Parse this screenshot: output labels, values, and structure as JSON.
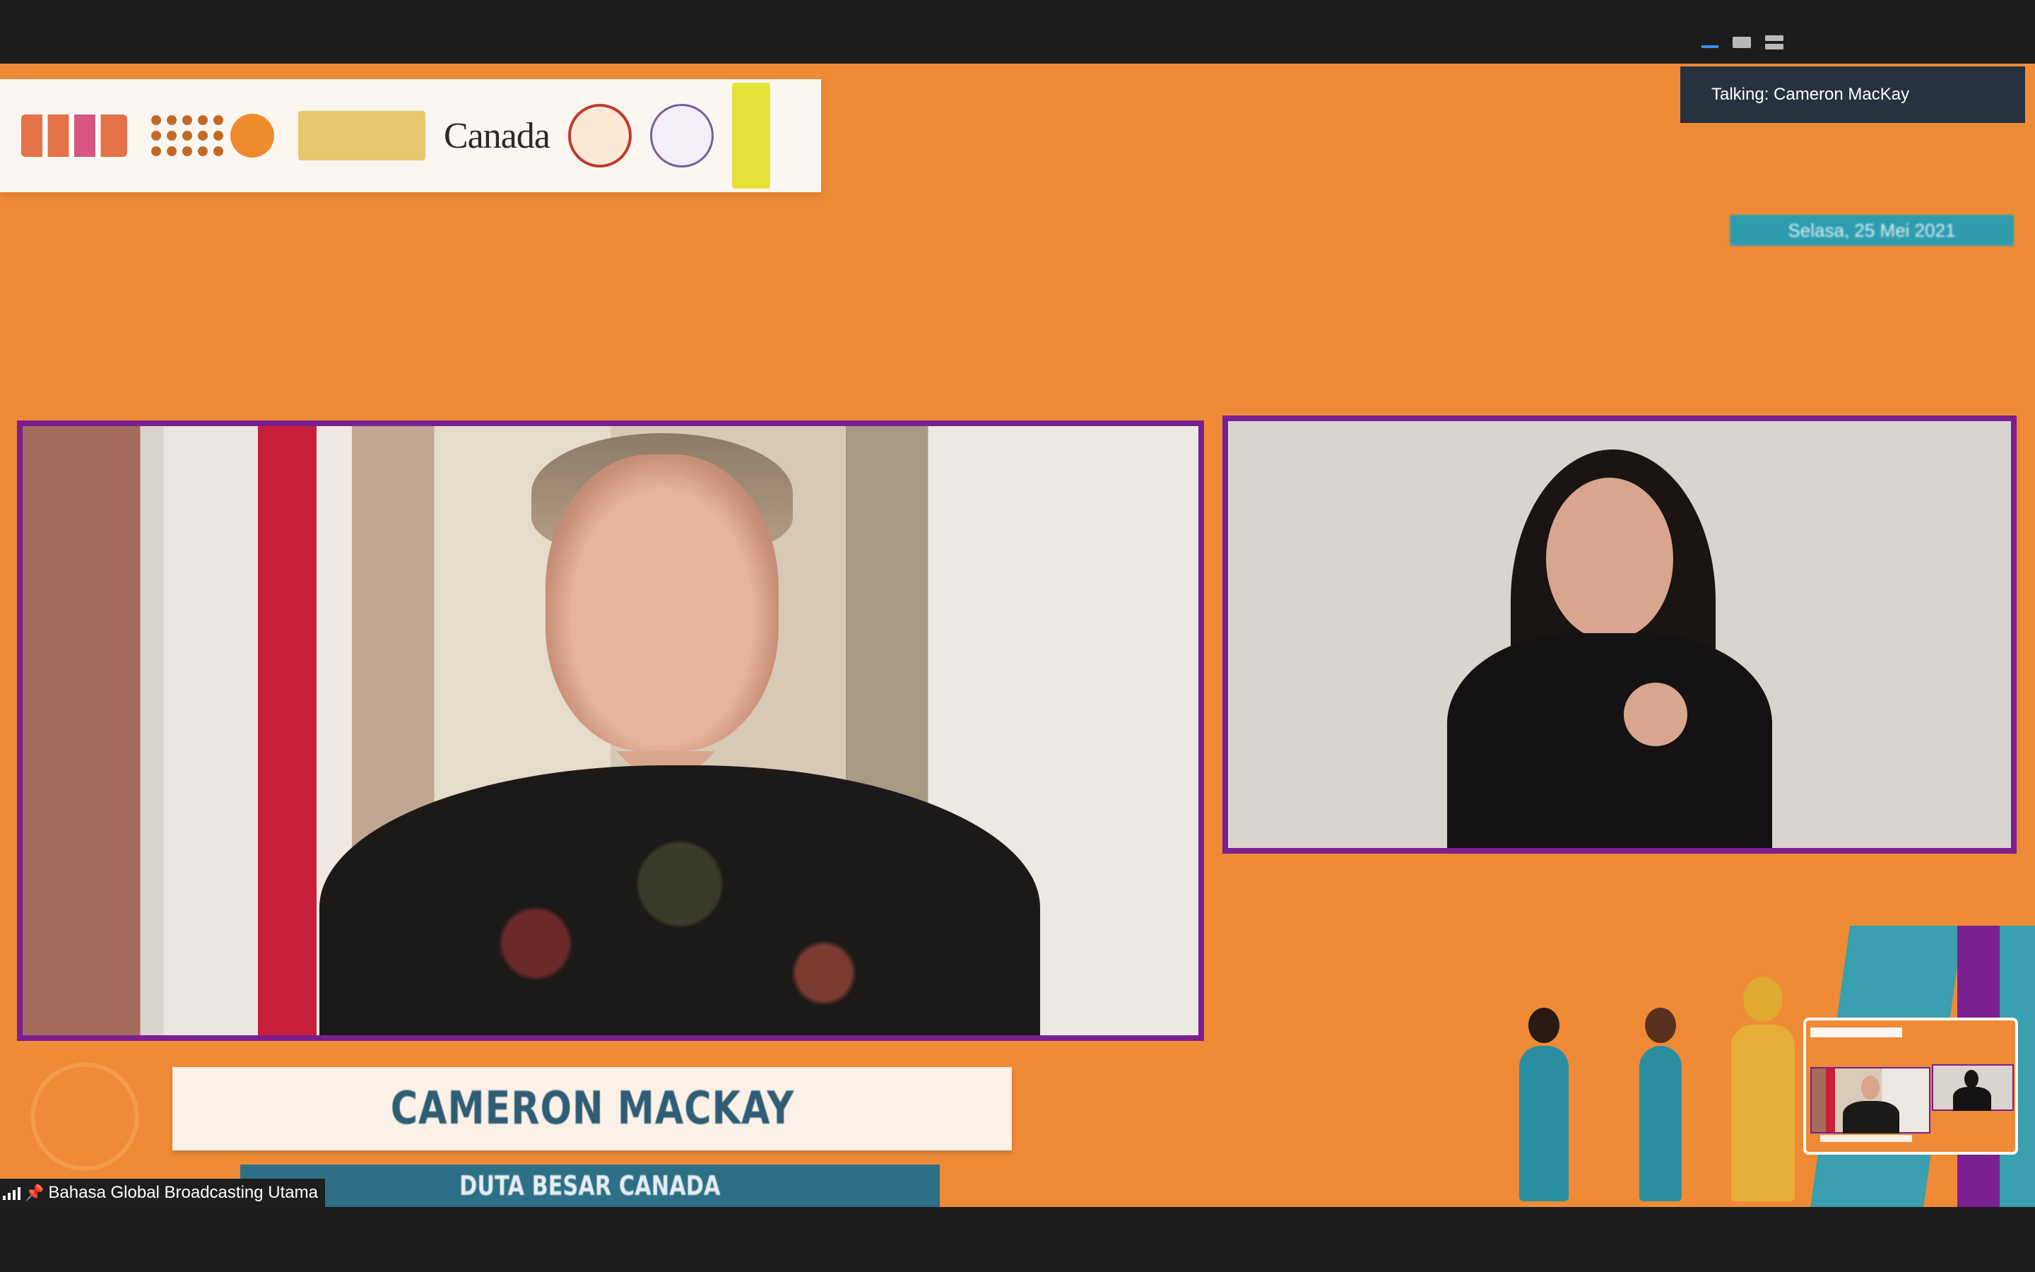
{
  "zoom": {
    "view_controls": [
      "minimize-view-icon",
      "single-view-icon",
      "side-by-side-view-icon"
    ],
    "talking_indicator": "Talking: Cameron MacKay",
    "pinned_participant": "Bahasa Global Broadcasting Utama",
    "accent_color": "#3b8ff0"
  },
  "broadcast": {
    "sponsor_logos": [
      "logo-1",
      "logo-2",
      "logo-3",
      "Canada",
      "logo-5",
      "logo-6",
      "logo-7"
    ],
    "canada_wordmark": "Canada",
    "speaker_name": "CAMERON MACKAY",
    "speaker_title": "DUTA BESAR CANADA",
    "event_date": "Selasa, 25 Mei 2021",
    "background_color": "#ef8a37",
    "frame_color": "#7a1f8f"
  }
}
